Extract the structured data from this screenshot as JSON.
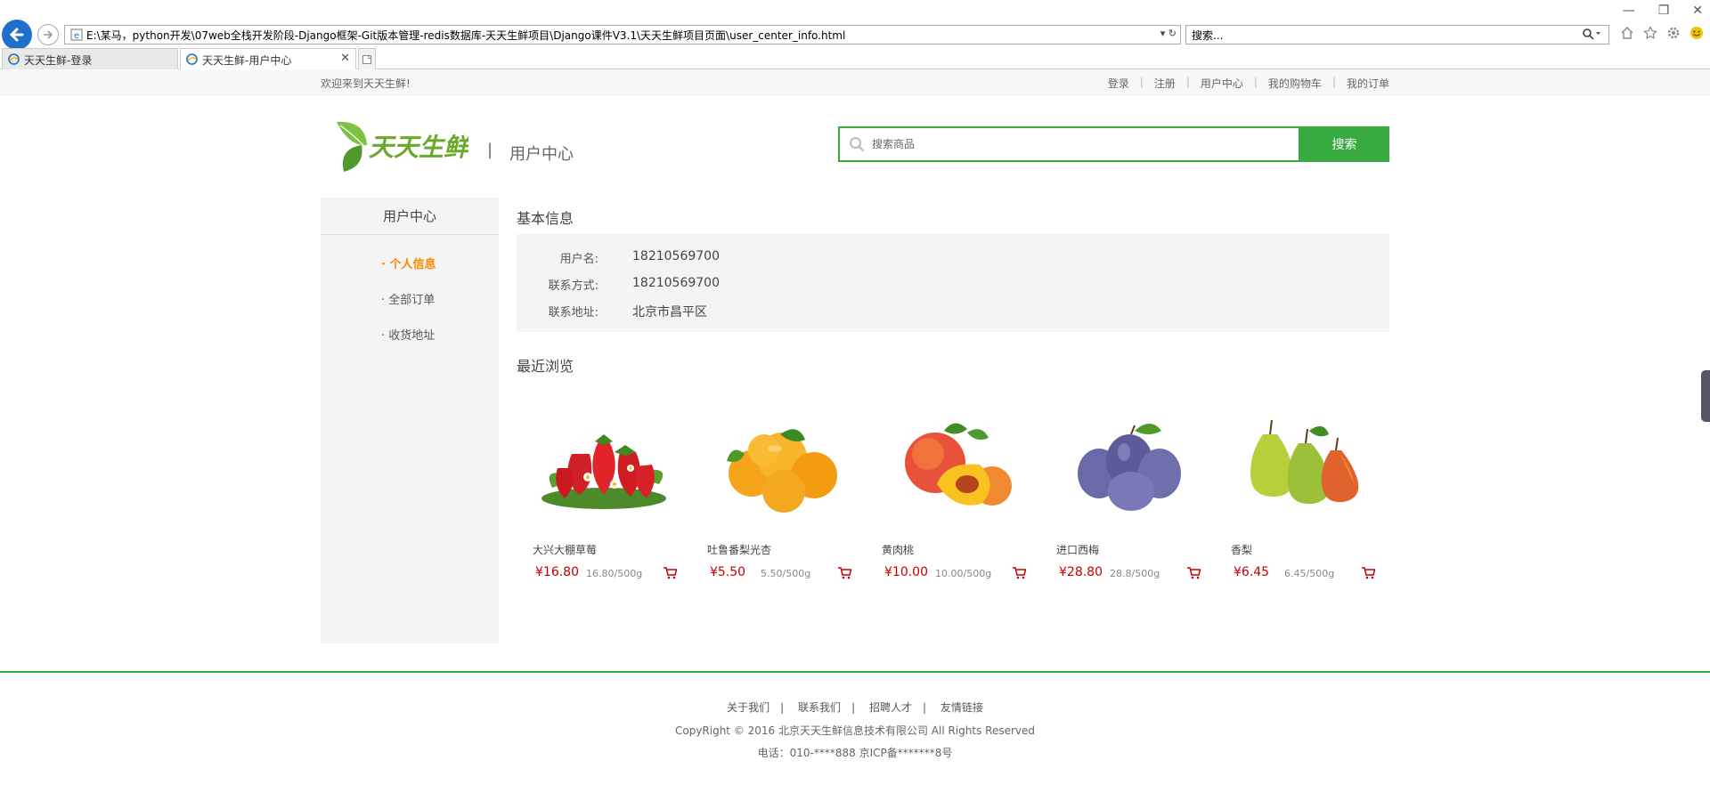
{
  "browser": {
    "address": "E:\\某马，python开发\\07web全栈开发阶段-Django框架-Git版本管理-redis数据库-天天生鲜项目\\Django课件V3.1\\天天生鲜项目页面\\user_center_info.html",
    "search_placeholder": "搜索...",
    "tabs": [
      {
        "title": "天天生鲜-登录"
      },
      {
        "title": "天天生鲜-用户中心"
      }
    ]
  },
  "topbar": {
    "welcome": "欢迎来到天天生鲜!",
    "links": [
      "登录",
      "注册",
      "用户中心",
      "我的购物车",
      "我的订单"
    ]
  },
  "header": {
    "logo_text": "天天生鲜",
    "divider": "|",
    "title": "用户中心",
    "search_placeholder": "搜索商品",
    "search_button": "搜索"
  },
  "sidebar": {
    "title": "用户中心",
    "items": [
      {
        "label": "· 个人信息",
        "active": true
      },
      {
        "label": "· 全部订单",
        "active": false
      },
      {
        "label": "· 收货地址",
        "active": false
      }
    ]
  },
  "basic_info": {
    "title": "基本信息",
    "rows": [
      {
        "label": "用户名:",
        "value": "18210569700"
      },
      {
        "label": "联系方式:",
        "value": "18210569700"
      },
      {
        "label": "联系地址:",
        "value": "北京市昌平区"
      }
    ]
  },
  "recent": {
    "title": "最近浏览",
    "products": [
      {
        "name": "大兴大棚草莓",
        "price": "¥16.80",
        "unit": "16.80/500g",
        "fruit": "strawberry"
      },
      {
        "name": "吐鲁番梨光杏",
        "price": "¥5.50",
        "unit": "5.50/500g",
        "fruit": "apricot"
      },
      {
        "name": "黄肉桃",
        "price": "¥10.00",
        "unit": "10.00/500g",
        "fruit": "peach"
      },
      {
        "name": "进口西梅",
        "price": "¥28.80",
        "unit": "28.8/500g",
        "fruit": "plum"
      },
      {
        "name": "香梨",
        "price": "¥6.45",
        "unit": "6.45/500g",
        "fruit": "pear"
      }
    ]
  },
  "footer": {
    "links": [
      "关于我们",
      "联系我们",
      "招聘人才",
      "友情链接"
    ],
    "copyright": "CopyRight © 2016 北京天天生鲜信息技术有限公司 All Rights Reserved",
    "tel": "电话：010-****888 京ICP备*******8号"
  },
  "colors": {
    "brand_green": "#37ab40",
    "price_red": "#c40000",
    "active_orange": "#ff8800"
  }
}
